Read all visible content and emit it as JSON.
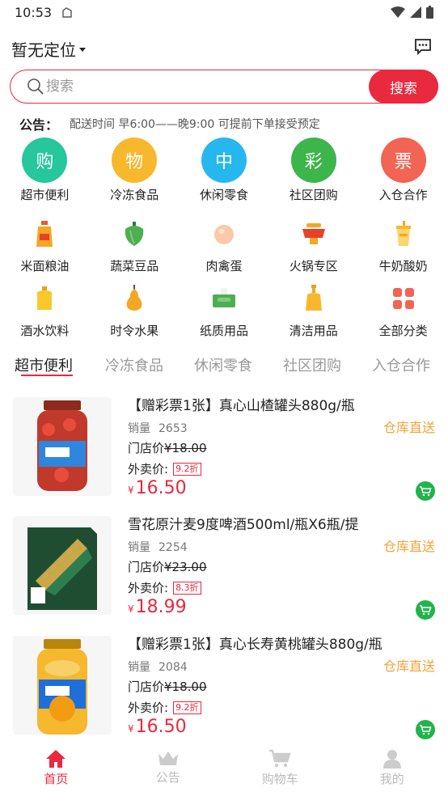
{
  "status": {
    "time": "10:53"
  },
  "header": {
    "location": "暂无定位"
  },
  "search": {
    "placeholder": "搜索",
    "button": "搜索"
  },
  "notice": {
    "label": "公告：",
    "text": "配送时间 早6:00——晚9:00 可提前下单接受预定"
  },
  "primary_categories": [
    {
      "glyph": "购",
      "label": "超市便利",
      "color": "#26c79a"
    },
    {
      "glyph": "物",
      "label": "冷冻食品",
      "color": "#f7b82d"
    },
    {
      "glyph": "中",
      "label": "休闲零食",
      "color": "#27b7ef"
    },
    {
      "glyph": "彩",
      "label": "社区团购",
      "color": "#3cb54a"
    },
    {
      "glyph": "票",
      "label": "入仓合作",
      "color": "#f26454"
    }
  ],
  "secondary_categories": [
    {
      "label": "米面粮油",
      "icon": "oil-bottle-icon"
    },
    {
      "label": "蔬菜豆品",
      "icon": "pepper-icon"
    },
    {
      "label": "肉禽蛋",
      "icon": "egg-icon"
    },
    {
      "label": "火锅专区",
      "icon": "hotpot-icon"
    },
    {
      "label": "牛奶酸奶",
      "icon": "milk-icon"
    },
    {
      "label": "酒水饮料",
      "icon": "drink-icon"
    },
    {
      "label": "时令水果",
      "icon": "pear-icon"
    },
    {
      "label": "纸质用品",
      "icon": "tissue-icon"
    },
    {
      "label": "清洁用品",
      "icon": "cleaner-icon"
    },
    {
      "label": "全部分类",
      "icon": "grid-icon"
    }
  ],
  "tabs": [
    "超市便利",
    "冷冻食品",
    "休闲零食",
    "社区团购",
    "入仓合作"
  ],
  "products": [
    {
      "title": "【赠彩票1张】真心山楂罐头880g/瓶",
      "sales_label": "销量",
      "sales": "2653",
      "tag": "仓库直送",
      "store_label": "门店价",
      "store_price": "¥18.00",
      "delivery_label": "外卖价:",
      "discount": "9.2折",
      "currency": "¥",
      "price": "16.50"
    },
    {
      "title": "雪花原汁麦9度啤酒500ml/瓶X6瓶/提",
      "sales_label": "销量",
      "sales": "2254",
      "tag": "仓库直送",
      "store_label": "门店价",
      "store_price": "¥23.00",
      "delivery_label": "外卖价:",
      "discount": "8.3折",
      "currency": "¥",
      "price": "18.99"
    },
    {
      "title": "【赠彩票1张】真心长寿黄桃罐头880g/瓶",
      "sales_label": "销量",
      "sales": "2084",
      "tag": "仓库直送",
      "store_label": "门店价",
      "store_price": "¥18.00",
      "delivery_label": "外卖价:",
      "discount": "9.2折",
      "currency": "¥",
      "price": "16.50"
    }
  ],
  "nav": [
    {
      "label": "首页",
      "icon": "home-icon"
    },
    {
      "label": "公告",
      "icon": "crown-icon"
    },
    {
      "label": "购物车",
      "icon": "cart-icon"
    },
    {
      "label": "我的",
      "icon": "user-icon"
    }
  ],
  "colors": {
    "accent": "#e8293e",
    "tag": "#f2a43a",
    "cart": "#22b34c"
  }
}
